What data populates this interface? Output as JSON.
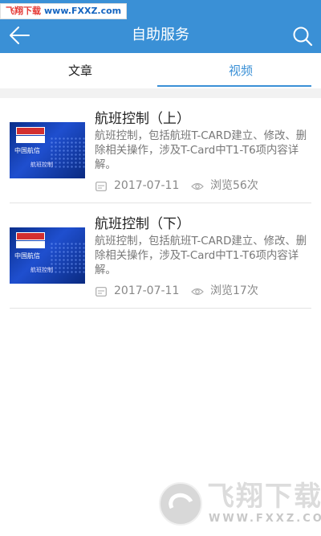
{
  "watermark_top": {
    "brand": "飞翔下载",
    "url": "www.FXXZ.com"
  },
  "header": {
    "title": "自助服务",
    "back_icon": "arrow-left-icon",
    "search_icon": "search-icon",
    "color": "#3a90d6"
  },
  "tabs": [
    {
      "label": "文章",
      "active": false
    },
    {
      "label": "视频",
      "active": true
    }
  ],
  "items": [
    {
      "title": "航班控制（上）",
      "description": "航班控制，包括航班T-CARD建立、修改、删除相关操作，涉及T-Card中T1-T6项内容详解。",
      "date": "2017-07-11",
      "views": "浏览56次",
      "thumb_text": "中国航信",
      "thumb_sub": "航班控制"
    },
    {
      "title": "航班控制（下）",
      "description": "航班控制，包括航班T-CARD建立、修改、删除相关操作，涉及T-Card中T1-T6项内容详解。",
      "date": "2017-07-11",
      "views": "浏览17次",
      "thumb_text": "中国航信",
      "thumb_sub": "航班控制"
    }
  ],
  "watermark_bottom": {
    "big": "飞翔下载",
    "small": "WWW.FXXZ.COM"
  }
}
